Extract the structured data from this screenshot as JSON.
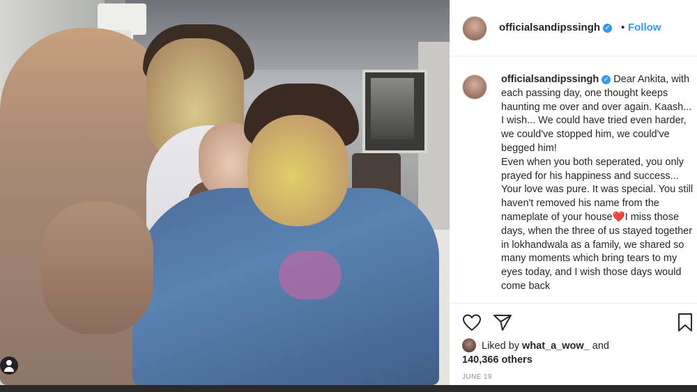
{
  "post": {
    "username": "officialsandipssingh",
    "follow_label": "Follow",
    "separator": "•",
    "caption_html_parts": [
      "Dear Ankita, with each passing day, one thought keeps haunting me over and over again. Kaash... I wish... We could have tried even harder, we could've stopped him, we could've begged him!",
      "Even when you both seperated, you only prayed for his happiness and success... Your love was pure. It was special. You still haven't removed his name from the nameplate of your house",
      "I miss those days, when the three of us stayed together in lokhandwala as a family, we shared so many moments which bring tears to my eyes today, and I wish those days would come back"
    ],
    "liked_by_prefix": "Liked by",
    "liked_by_user": "what_a_wow_",
    "liked_by_and": "and",
    "likes_count": "140,366 others",
    "date": "JUNE 19"
  },
  "icons": {
    "like": "heart-outline-icon",
    "share": "paper-plane-icon",
    "save": "bookmark-icon",
    "verified": "verified-badge-icon",
    "user": "user-icon"
  },
  "colors": {
    "accent": "#3897f0",
    "text": "#262626",
    "muted": "#8e8e8e",
    "heart": "#ed4956"
  }
}
